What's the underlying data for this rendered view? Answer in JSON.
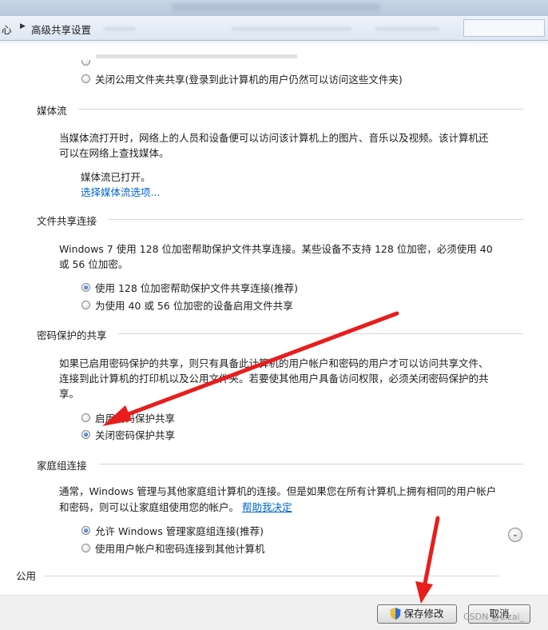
{
  "address": {
    "prefix": "心",
    "current": "高级共享设置"
  },
  "public_folder": {
    "option_off": "关闭公用文件夹共享(登录到此计算机的用户仍然可以访问这些文件夹)"
  },
  "media": {
    "title": "媒体流",
    "desc_line1": "当媒体流打开时，网络上的人员和设备便可以访问该计算机上的图片、音乐以及视频。该计算机还",
    "desc_line2": "可以在网络上查找媒体。",
    "status": "媒体流已打开。",
    "link": "选择媒体流选项..."
  },
  "file_sharing": {
    "title": "文件共享连接",
    "desc_line1": "Windows 7 使用 128 位加密帮助保护文件共享连接。某些设备不支持 128 位加密，必须使用 40",
    "desc_line2": "或 56 位加密。",
    "option1": "使用 128 位加密帮助保护文件共享连接(推荐)",
    "option2": "为使用 40 或 56 位加密的设备启用文件共享"
  },
  "password": {
    "title": "密码保护的共享",
    "desc_line1": "如果已启用密码保护的共享，则只有具备此计算机的用户帐户和密码的用户才可以访问共享文件、",
    "desc_line2": "连接到此计算机的打印机以及公用文件夹。若要使其他用户具备访问权限，必须关闭密码保护的共",
    "desc_line3": "享。",
    "option_on": "启用密码保护共享",
    "option_off": "关闭密码保护共享"
  },
  "homegroup": {
    "title": "家庭组连接",
    "desc_line1": "通常，Windows 管理与其他家庭组计算机的连接。但是如果您在所有计算机上拥有相同的用户帐户",
    "desc_line2": "和密码，则可以让家庭组使用您的帐户。",
    "help_link": "帮助我决定",
    "option1": "允许 Windows 管理家庭组连接(推荐)",
    "option2": "使用用户帐户和密码连接到其他计算机"
  },
  "public_section": {
    "title": "公用"
  },
  "buttons": {
    "save": "保存修改",
    "cancel": "取消"
  },
  "watermark": "CSDN @Lizai_",
  "icons": {
    "expand": "chevron-down-icon",
    "shield": "uac-shield-icon",
    "breadcrumb_arrow": "triangle-right-icon"
  },
  "colors": {
    "annotation_arrow": "#e81d1d",
    "link": "#0066cc"
  }
}
